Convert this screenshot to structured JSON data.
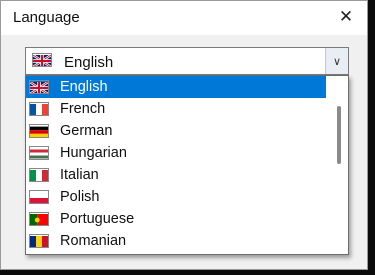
{
  "dialog": {
    "title": "Language",
    "close_label": "✕"
  },
  "combo": {
    "selected": "English",
    "selected_flag": "uk",
    "arrow_icon": "chevron-down-icon"
  },
  "options": [
    {
      "label": "English",
      "flag": "uk",
      "selected": true
    },
    {
      "label": "French",
      "flag": "fr",
      "selected": false
    },
    {
      "label": "German",
      "flag": "de",
      "selected": false
    },
    {
      "label": "Hungarian",
      "flag": "hu",
      "selected": false
    },
    {
      "label": "Italian",
      "flag": "it",
      "selected": false
    },
    {
      "label": "Polish",
      "flag": "pl",
      "selected": false
    },
    {
      "label": "Portuguese",
      "flag": "pt",
      "selected": false
    },
    {
      "label": "Romanian",
      "flag": "ro",
      "selected": false
    }
  ],
  "colors": {
    "selection": "#0078d7",
    "background_terminal_text": "#31e25a"
  }
}
